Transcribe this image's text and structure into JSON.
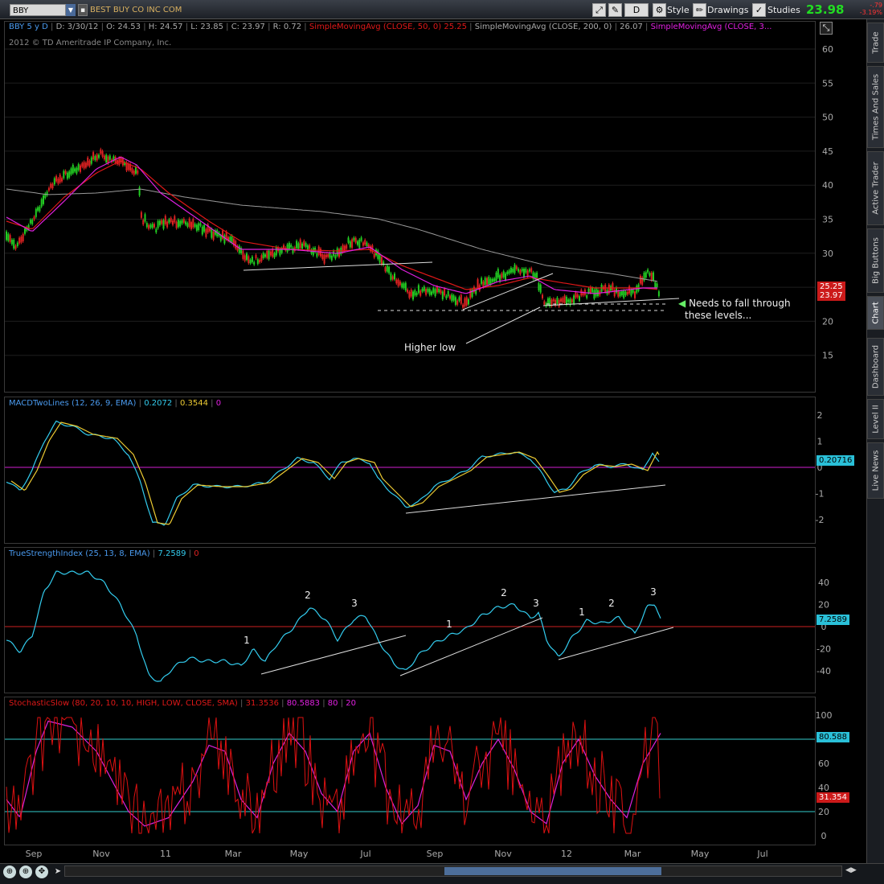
{
  "toolbar": {
    "symbol": "BBY",
    "company": "BEST BUY CO INC COM",
    "mode": "D",
    "style_label": "Style",
    "drawings_label": "Drawings",
    "studies_label": "Studies",
    "last_price": "23.98",
    "change": "-.79",
    "change_pct": "-3.19%"
  },
  "header": {
    "symbol_period": "BBY 5 y D",
    "date": "D: 3/30/12",
    "open": "O: 24.53",
    "high": "H: 24.57",
    "low": "L: 23.85",
    "close": "C: 23.97",
    "range": "R: 0.72",
    "sma50_label": "SimpleMovingAvg (CLOSE, 50, 0)",
    "sma50_value": "25.25",
    "sma200_label": "SimpleMovingAvg (CLOSE, 200, 0)",
    "sma200_value": "26.07",
    "sma3_label": "SimpleMovingAvg (CLOSE, 3...",
    "copyright": "2012 © TD Ameritrade IP Company, Inc."
  },
  "price_panel": {
    "y_ticks": [
      "60",
      "55",
      "50",
      "45",
      "40",
      "35",
      "30",
      "25",
      "20",
      "15"
    ],
    "tag_sma": "25.25",
    "tag_close": "23.97",
    "annotation_needs": "Needs to fall through",
    "annotation_levels": "these levels...",
    "annotation_higher_low": "Higher low"
  },
  "macd_panel": {
    "label": "MACDTwoLines (12, 26, 9, EMA)",
    "v1": "0.2072",
    "v2": "0.3544",
    "v3": "0",
    "y_ticks": [
      "2",
      "1",
      "0",
      "-1",
      "-2"
    ],
    "tag": "0.20716"
  },
  "tsi_panel": {
    "label": "TrueStrengthIndex (25, 13, 8, EMA)",
    "v1": "7.2589",
    "v2": "0",
    "y_ticks": [
      "40",
      "20",
      "0",
      "-20",
      "-40"
    ],
    "tag": "7.2589",
    "marks": [
      "1",
      "2",
      "3",
      "1",
      "2",
      "3",
      "1",
      "2",
      "3"
    ]
  },
  "stoch_panel": {
    "label": "StochasticSlow (80, 20, 10, 10, HIGH, LOW, CLOSE, SMA)",
    "v1": "31.3536",
    "v2": "80.5883",
    "v3": "80",
    "v4": "20",
    "y_ticks": [
      "100",
      "80",
      "60",
      "40",
      "20",
      "0"
    ],
    "tag_k": "80.588",
    "tag_d": "31.354"
  },
  "x_axis": [
    "Sep",
    "Nov",
    "11",
    "Mar",
    "May",
    "Jul",
    "Sep",
    "Nov",
    "12",
    "Mar",
    "May",
    "Jul"
  ],
  "sidebar": [
    "Trade",
    "Times And Sales",
    "Active Trader",
    "Big Buttons",
    "Chart",
    "Dashboard",
    "Level II",
    "Live News"
  ],
  "colors": {
    "up": "#22cc22",
    "down": "#dd2222",
    "sma50": "#e01818",
    "sma200": "#9a9a9a",
    "sma3": "#e020e0",
    "macd": "#33ccee",
    "signal": "#eecc33",
    "tsi": "#33ccee",
    "stoch_k": "#dd1111",
    "stoch_d": "#dd22dd",
    "hline": "#33cccc"
  }
}
